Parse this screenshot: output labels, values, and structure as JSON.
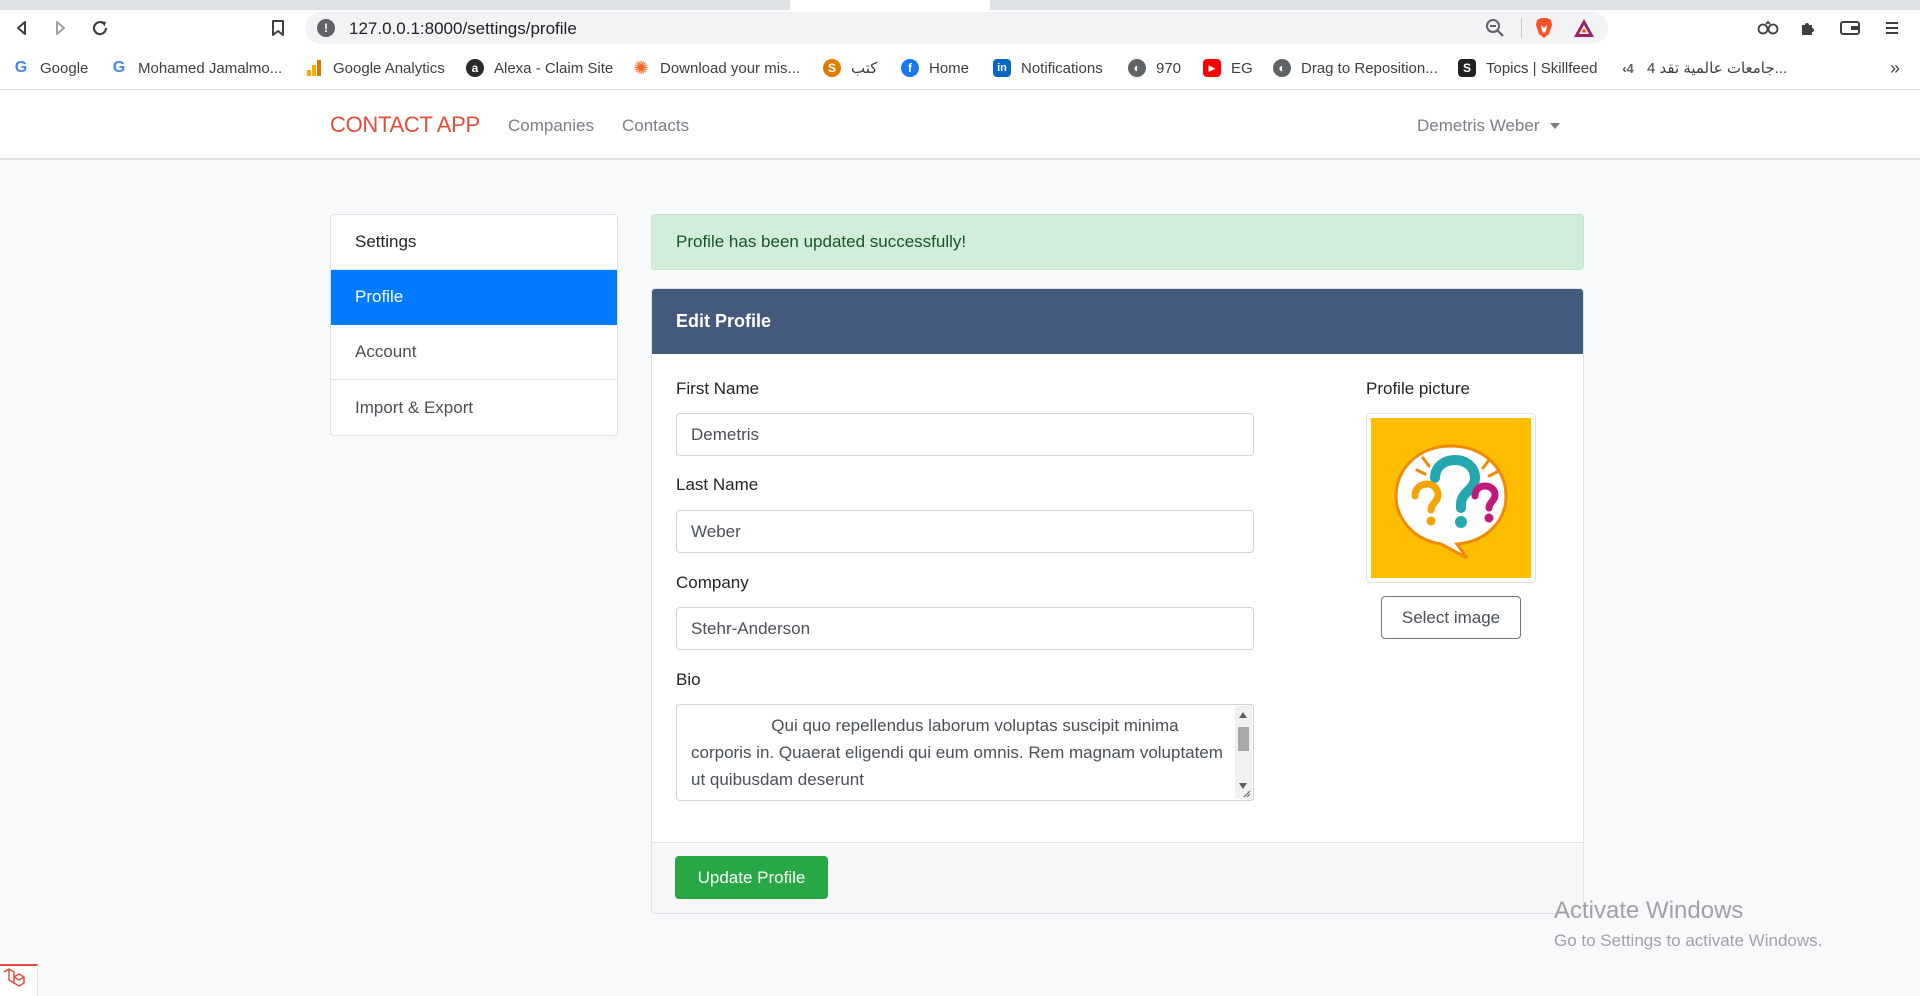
{
  "browser": {
    "url": "127.0.0.1:8000/settings/profile",
    "bookmarks": [
      {
        "label": "Google",
        "icon": "google-icon"
      },
      {
        "label": "Mohamed Jamalmo...",
        "icon": "google-icon"
      },
      {
        "label": "Google Analytics",
        "icon": "analytics-icon"
      },
      {
        "label": "Alexa - Claim Site",
        "icon": "alexa-icon"
      },
      {
        "label": "Download your mis...",
        "icon": "gear-icon"
      },
      {
        "label": "كتب",
        "icon": "book-icon"
      },
      {
        "label": "Home",
        "icon": "facebook-icon"
      },
      {
        "label": "Notifications",
        "icon": "linkedin-icon"
      },
      {
        "label": "970",
        "icon": "globe-icon"
      },
      {
        "label": "EG",
        "icon": "youtube-icon"
      },
      {
        "label": "Drag to Reposition...",
        "icon": "globe-icon"
      },
      {
        "label": "Topics | Skillfeed",
        "icon": "skillfeed-icon"
      },
      {
        "label": "4 جامعات عالمية تقد...",
        "icon": "arabic-site-icon"
      }
    ],
    "more_glyph": "»"
  },
  "navbar": {
    "brand": "CONTACT APP",
    "links": [
      "Companies",
      "Contacts"
    ],
    "user": "Demetris Weber"
  },
  "sidebar": {
    "items": [
      {
        "label": "Settings"
      },
      {
        "label": "Profile"
      },
      {
        "label": "Account"
      },
      {
        "label": "Import & Export"
      }
    ]
  },
  "alert": {
    "message": "Profile has been updated successfully!"
  },
  "form": {
    "title": "Edit Profile",
    "first_name_label": "First Name",
    "first_name_value": "Demetris",
    "last_name_label": "Last Name",
    "last_name_value": "Weber",
    "company_label": "Company",
    "company_value": "Stehr-Anderson",
    "bio_label": "Bio",
    "bio_value": "                 Qui quo repellendus laborum voluptas suscipit minima corporis in. Quaerat eligendi qui eum omnis. Rem magnam voluptatem ut quibusdam deserunt",
    "picture_label": "Profile picture",
    "select_image_label": "Select image",
    "submit_label": "Update Profile"
  },
  "watermark": {
    "title": "Activate Windows",
    "subtitle": "Go to Settings to activate Windows."
  },
  "colors": {
    "brand": "#e74c3c",
    "active": "#007bff",
    "card_header": "#435a7c",
    "success": "#28a745",
    "alert_bg": "#d4edda"
  }
}
